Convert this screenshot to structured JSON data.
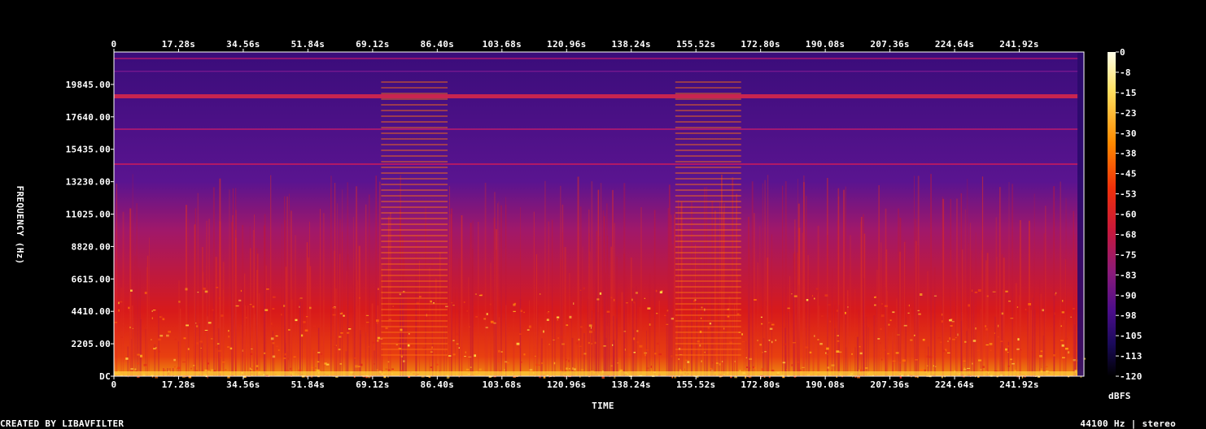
{
  "chart_data": {
    "type": "heatmap",
    "xlabel": "TIME",
    "ylabel": "FREQUENCY (Hz)",
    "x_ticks": [
      "0",
      "17.28s",
      "34.56s",
      "51.84s",
      "69.12s",
      "86.40s",
      "103.68s",
      "120.96s",
      "138.24s",
      "155.52s",
      "172.80s",
      "190.08s",
      "207.36s",
      "224.64s",
      "241.92s"
    ],
    "x_tick_values": [
      0,
      17.28,
      34.56,
      51.84,
      69.12,
      86.4,
      103.68,
      120.96,
      138.24,
      155.52,
      172.8,
      190.08,
      207.36,
      224.64,
      241.92
    ],
    "xlim": [
      0,
      259.2
    ],
    "y_ticks": [
      "DC",
      "2205.00",
      "4410.00",
      "6615.00",
      "8820.00",
      "11025.00",
      "13230.00",
      "15435.00",
      "17640.00",
      "19845.00"
    ],
    "y_tick_values": [
      0,
      2205,
      4410,
      6615,
      8820,
      11025,
      13230,
      15435,
      17640,
      19845
    ],
    "ylim": [
      0,
      22050
    ],
    "colorbar": {
      "label": "dBFS",
      "ticks": [
        "0",
        "-8",
        "-15",
        "-23",
        "-30",
        "-38",
        "-45",
        "-53",
        "-60",
        "-68",
        "-75",
        "-83",
        "-90",
        "-98",
        "-105",
        "-113",
        "-120"
      ],
      "range": [
        -120,
        0
      ]
    },
    "notes": {
      "bottom_left": "CREATED BY LIBAVFILTER",
      "bottom_right": "44100 Hz | stereo"
    },
    "colors": [
      "#000000",
      "#1a0a5a",
      "#4a0d8a",
      "#8a1a7a",
      "#c8183a",
      "#f0300a",
      "#ff8a00",
      "#ffd84a",
      "#ffffe8"
    ]
  }
}
